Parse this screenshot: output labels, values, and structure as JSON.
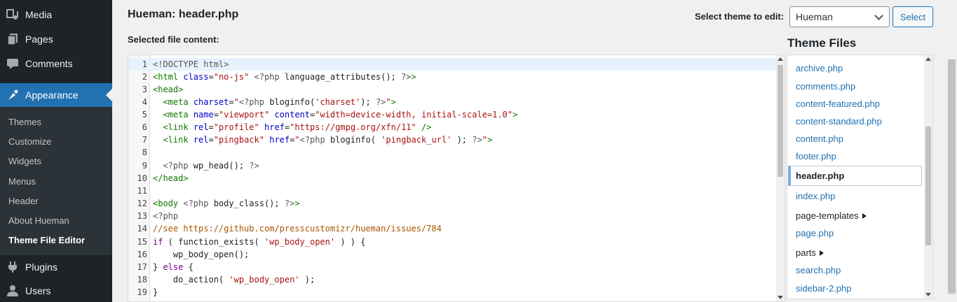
{
  "sidebar": {
    "top_items": [
      {
        "label": "Media",
        "icon": "media-icon"
      },
      {
        "label": "Pages",
        "icon": "pages-icon"
      },
      {
        "label": "Comments",
        "icon": "comments-icon"
      }
    ],
    "appearance": {
      "label": "Appearance",
      "icon": "appearance-icon"
    },
    "submenu": [
      "Themes",
      "Customize",
      "Widgets",
      "Menus",
      "Header",
      "About Hueman",
      "Theme File Editor"
    ],
    "bottom_items": [
      {
        "label": "Plugins",
        "icon": "plugins-icon"
      },
      {
        "label": "Users",
        "icon": "users-icon"
      }
    ],
    "accent_color": "#2271b1"
  },
  "header": {
    "title": "Hueman: header.php",
    "select_label": "Select theme to edit:",
    "selected_theme": "Hueman",
    "select_button": "Select"
  },
  "editor": {
    "label": "Selected file content:",
    "line_numbers": [
      "1",
      "2",
      "3",
      "4",
      "5",
      "6",
      "7",
      "8",
      "9",
      "10",
      "11",
      "12",
      "13",
      "14",
      "15",
      "16",
      "17",
      "18",
      "19"
    ],
    "lines": [
      "<!DOCTYPE html>",
      "<html class=\"no-js\" <?php language_attributes(); ?>>",
      "<head>",
      "  <meta charset=\"<?php bloginfo('charset'); ?>\">",
      "  <meta name=\"viewport\" content=\"width=device-width, initial-scale=1.0\">",
      "  <link rel=\"profile\" href=\"https://gmpg.org/xfn/11\" />",
      "  <link rel=\"pingback\" href=\"<?php bloginfo( 'pingback_url' ); ?>\">",
      "",
      "  <?php wp_head(); ?>",
      "</head>",
      "",
      "<body <?php body_class(); ?>>",
      "<?php",
      "//see https://github.com/presscustomizr/hueman/issues/784",
      "if ( function_exists( 'wp_body_open' ) ) {",
      "    wp_body_open();",
      "} else {",
      "    do_action( 'wp_body_open' );",
      "}"
    ]
  },
  "theme_files": {
    "title": "Theme Files",
    "files": [
      "archive.php",
      "comments.php",
      "content-featured.php",
      "content-standard.php",
      "content.php",
      "footer.php",
      "header.php",
      "index.php",
      "page-templates",
      "page.php",
      "parts",
      "search.php",
      "sidebar-2.php"
    ],
    "current": "header.php"
  }
}
